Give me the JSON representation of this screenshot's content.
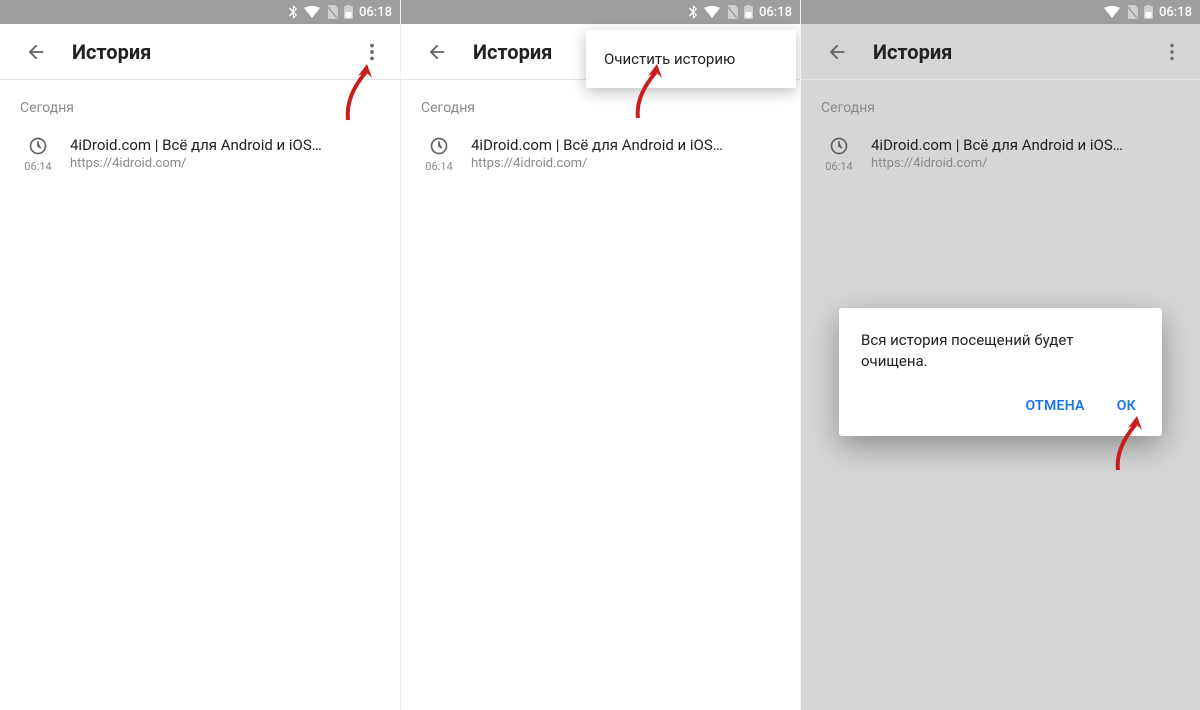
{
  "status": {
    "time": "06:18"
  },
  "appbar": {
    "title": "История"
  },
  "section": {
    "today": "Сегодня"
  },
  "history": {
    "item_time": "06:14",
    "item_title": "4iDroid.com | Всё для Android и iOS…",
    "item_url": "https://4idroid.com/"
  },
  "menu": {
    "clear": "Очистить историю"
  },
  "dialog": {
    "message": "Вся история посещений будет очищена.",
    "cancel": "ОТМЕНА",
    "ok": "ОК"
  }
}
